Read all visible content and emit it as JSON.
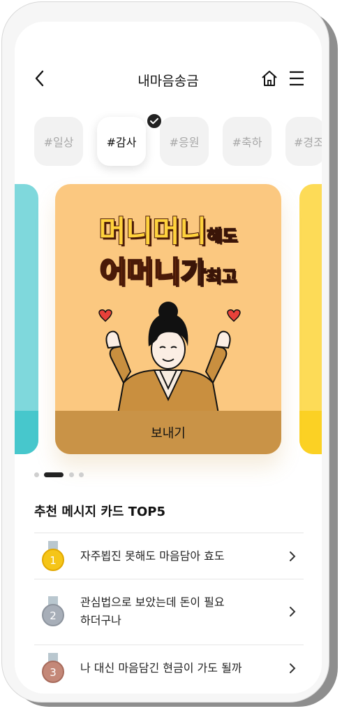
{
  "header": {
    "title": "내마음송금"
  },
  "tags": [
    {
      "label": "#일상",
      "selected": false
    },
    {
      "label": "#감사",
      "selected": true
    },
    {
      "label": "#응원",
      "selected": false
    },
    {
      "label": "#축하",
      "selected": false
    },
    {
      "label": "#경조",
      "selected": false
    }
  ],
  "card": {
    "line1_big": "머니머니",
    "line1_small": "해도",
    "line2_big_orange": "어머니",
    "line2_big_white": "가",
    "line2_small": "최고",
    "send_label": "보내기",
    "background_color": "#fbc880",
    "button_color": "#c99347"
  },
  "carousel": {
    "page_count": 4,
    "active_index": 1
  },
  "recommended": {
    "title": "추천 메시지 카드 TOP5",
    "items": [
      {
        "rank": "1",
        "text": "자주뵙진 못해도 마음담아 효도",
        "medal_color": "#f5c518"
      },
      {
        "rank": "2",
        "text": "관심법으로 보았는데 돈이 필요\n하더구나",
        "medal_color": "#a7aeb8"
      },
      {
        "rank": "3",
        "text": "나 대신 마음담긴 현금이 가도 될까",
        "medal_color": "#c48878"
      }
    ]
  }
}
